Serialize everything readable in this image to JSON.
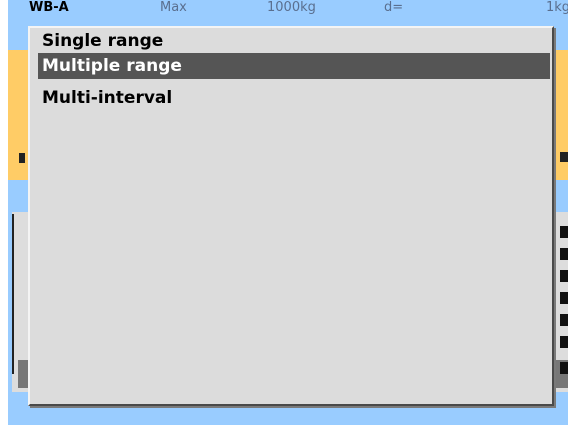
{
  "background_screen": {
    "header": {
      "name": "WB-A",
      "max_label": "Max",
      "capacity": "1000kg",
      "d_label": "d=",
      "d_value": "1kg"
    }
  },
  "menu": {
    "items": [
      {
        "label": "Single range",
        "selected": false
      },
      {
        "label": "Multiple range",
        "selected": true
      },
      {
        "label": "Multi-interval",
        "selected": false
      }
    ]
  },
  "colors": {
    "screen_blue": "#99ccff",
    "band_orange": "#ffcc66",
    "popup_gray": "#dcdcdc",
    "selection_dark": "#555555"
  }
}
